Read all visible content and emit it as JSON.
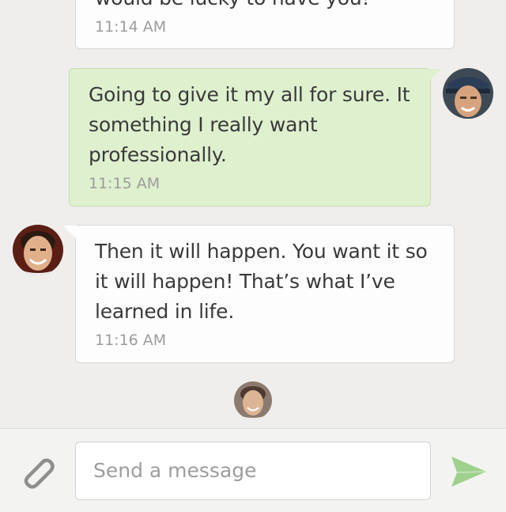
{
  "messages": [
    {
      "direction": "incoming",
      "text": "would be lucky to have you!",
      "time": "11:14 AM"
    },
    {
      "direction": "outgoing",
      "lines": [
        "Going to give it my all for sure. It",
        "something I really want",
        "professionally."
      ],
      "time": "11:15 AM"
    },
    {
      "direction": "incoming",
      "lines": [
        "Then it will happen. You want it so",
        "it will happen! That’s what I’ve",
        "learned in life."
      ],
      "time": "11:16 AM"
    }
  ],
  "composer": {
    "placeholder": "Send a message",
    "attach_icon": "paperclip-icon",
    "send_icon": "send-arrow-icon"
  },
  "colors": {
    "background": "#efeeec",
    "incoming_bubble": "#fdfdfd",
    "outgoing_bubble": "#dff0cf",
    "send_accent": "#9fd08e"
  }
}
